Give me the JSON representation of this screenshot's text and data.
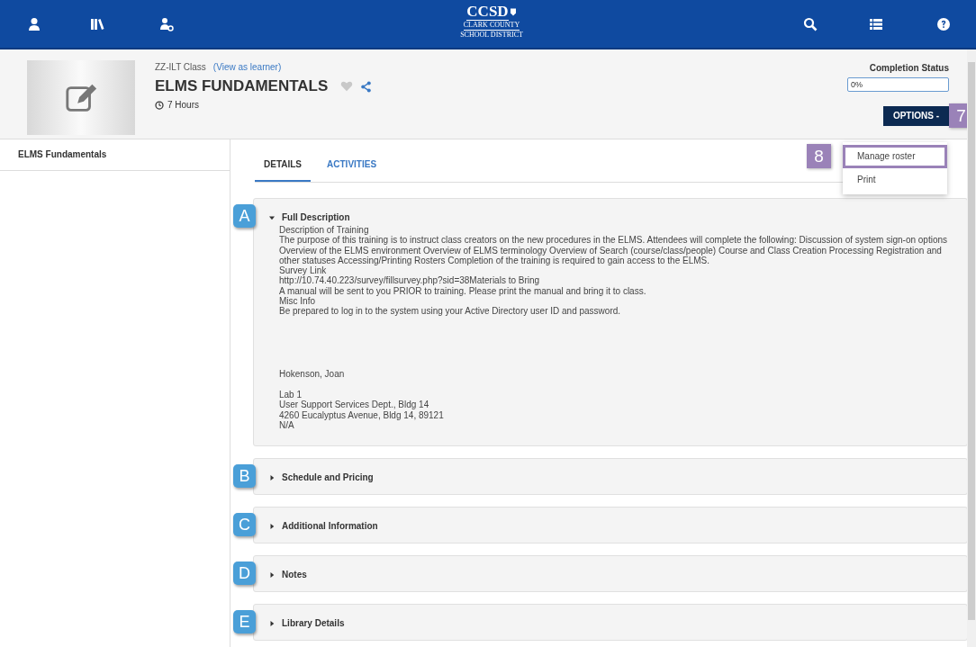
{
  "nav": {
    "logo": {
      "name": "CCSD",
      "line1": "CLARK COUNTY",
      "line2": "SCHOOL DISTRICT"
    }
  },
  "header": {
    "class_type": "ZZ-ILT Class",
    "view_link": "(View as learner)",
    "title": "ELMS FUNDAMENTALS",
    "duration": "7 Hours",
    "completion_label": "Completion Status",
    "completion_value": "0%",
    "options_button": "OPTIONS -",
    "options_callout": "7"
  },
  "options_menu": {
    "items": [
      {
        "label": "Manage roster",
        "callout": "8"
      },
      {
        "label": "Print"
      }
    ]
  },
  "sidebar": {
    "items": [
      {
        "label": "ELMS Fundamentals"
      }
    ]
  },
  "tabs": [
    {
      "label": "DETAILS",
      "selected": true
    },
    {
      "label": "ACTIVITIES",
      "selected": false
    }
  ],
  "sections": [
    {
      "callout": "A",
      "title": "Full Description",
      "expanded": true,
      "groups": [
        [
          "Description of Training",
          "The purpose of this training is to instruct class creators on the new procedures in the ELMS. Attendees will complete the following: Discussion of system sign-on options Overview of the ELMS environment Overview of ELMS terminology Overview of Search (course/class/people) Course and Class Creation Processing Registration and other statuses Accessing/Printing Rosters Completion of the training is required to gain access to the ELMS.",
          "Survey Link",
          "http://10.74.40.223/survey/fillsurvey.php?sid=38Materials to Bring",
          "A manual will be sent to you PRIOR to training. Please print the manual and bring it to class.",
          "Misc Info",
          "Be prepared to log in to the system using your Active Directory user ID and password."
        ],
        [
          "Hokenson, Joan"
        ],
        [
          "Lab 1",
          "User Support Services Dept., Bldg 14",
          "4260 Eucalyptus Avenue, Bldg 14, 89121",
          "N/A"
        ]
      ]
    },
    {
      "callout": "B",
      "title": "Schedule and Pricing",
      "expanded": false
    },
    {
      "callout": "C",
      "title": "Additional Information",
      "expanded": false
    },
    {
      "callout": "D",
      "title": "Notes",
      "expanded": false
    },
    {
      "callout": "E",
      "title": "Library Details",
      "expanded": false
    }
  ]
}
